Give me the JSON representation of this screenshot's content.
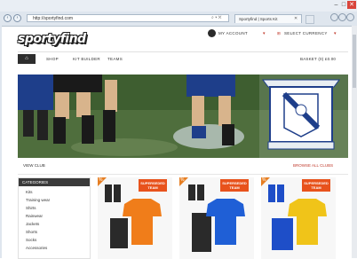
{
  "browser": {
    "url": "http://sportyfind.com",
    "tab_title": "Sportyfind | Sports Kit",
    "window_controls": {
      "minimize": "–",
      "maximize": "□",
      "close": "✕"
    },
    "nav": {
      "back": "‹",
      "forward": "›"
    },
    "addr_icons": "⌕ ▾ ✕"
  },
  "site": {
    "logo": "sportyfind",
    "header": {
      "account_label": "MY ACCOUNT",
      "currency_label": "SELECT CURRENCY"
    },
    "nav": {
      "home": "⌂",
      "items": [
        "SHOP",
        "KIT BUILDER",
        "TEAMS"
      ],
      "basket": "BASKET (0) £0.00"
    },
    "banner_caption_left": "VIEW CLUB",
    "banner_caption_right": "BROWSE ALL CLUBS",
    "sidebar": {
      "title": "CATEGORIES",
      "items": [
        "Kits",
        "Training wear",
        "Shirts",
        "Rainwear",
        "Jackets",
        "Shorts",
        "Socks",
        "Accessories"
      ]
    },
    "products": [
      {
        "ribbon": "%",
        "tag": "SUPERSEDED TEAM",
        "shirt_color": "#f07d1a",
        "shorts_color": "#2a2a2a",
        "socks_color": "#2a2a2a"
      },
      {
        "ribbon": "%",
        "tag": "SUPERSEDED TEAM",
        "shirt_color": "#1f5fd6",
        "shorts_color": "#2a2a2a",
        "socks_color": "#2a2a2a"
      },
      {
        "ribbon": "%",
        "tag": "SUPERSEDED TEAM",
        "shirt_color": "#f0c419",
        "shorts_color": "#1e4ec8",
        "socks_color": "#1e4ec8"
      }
    ]
  }
}
